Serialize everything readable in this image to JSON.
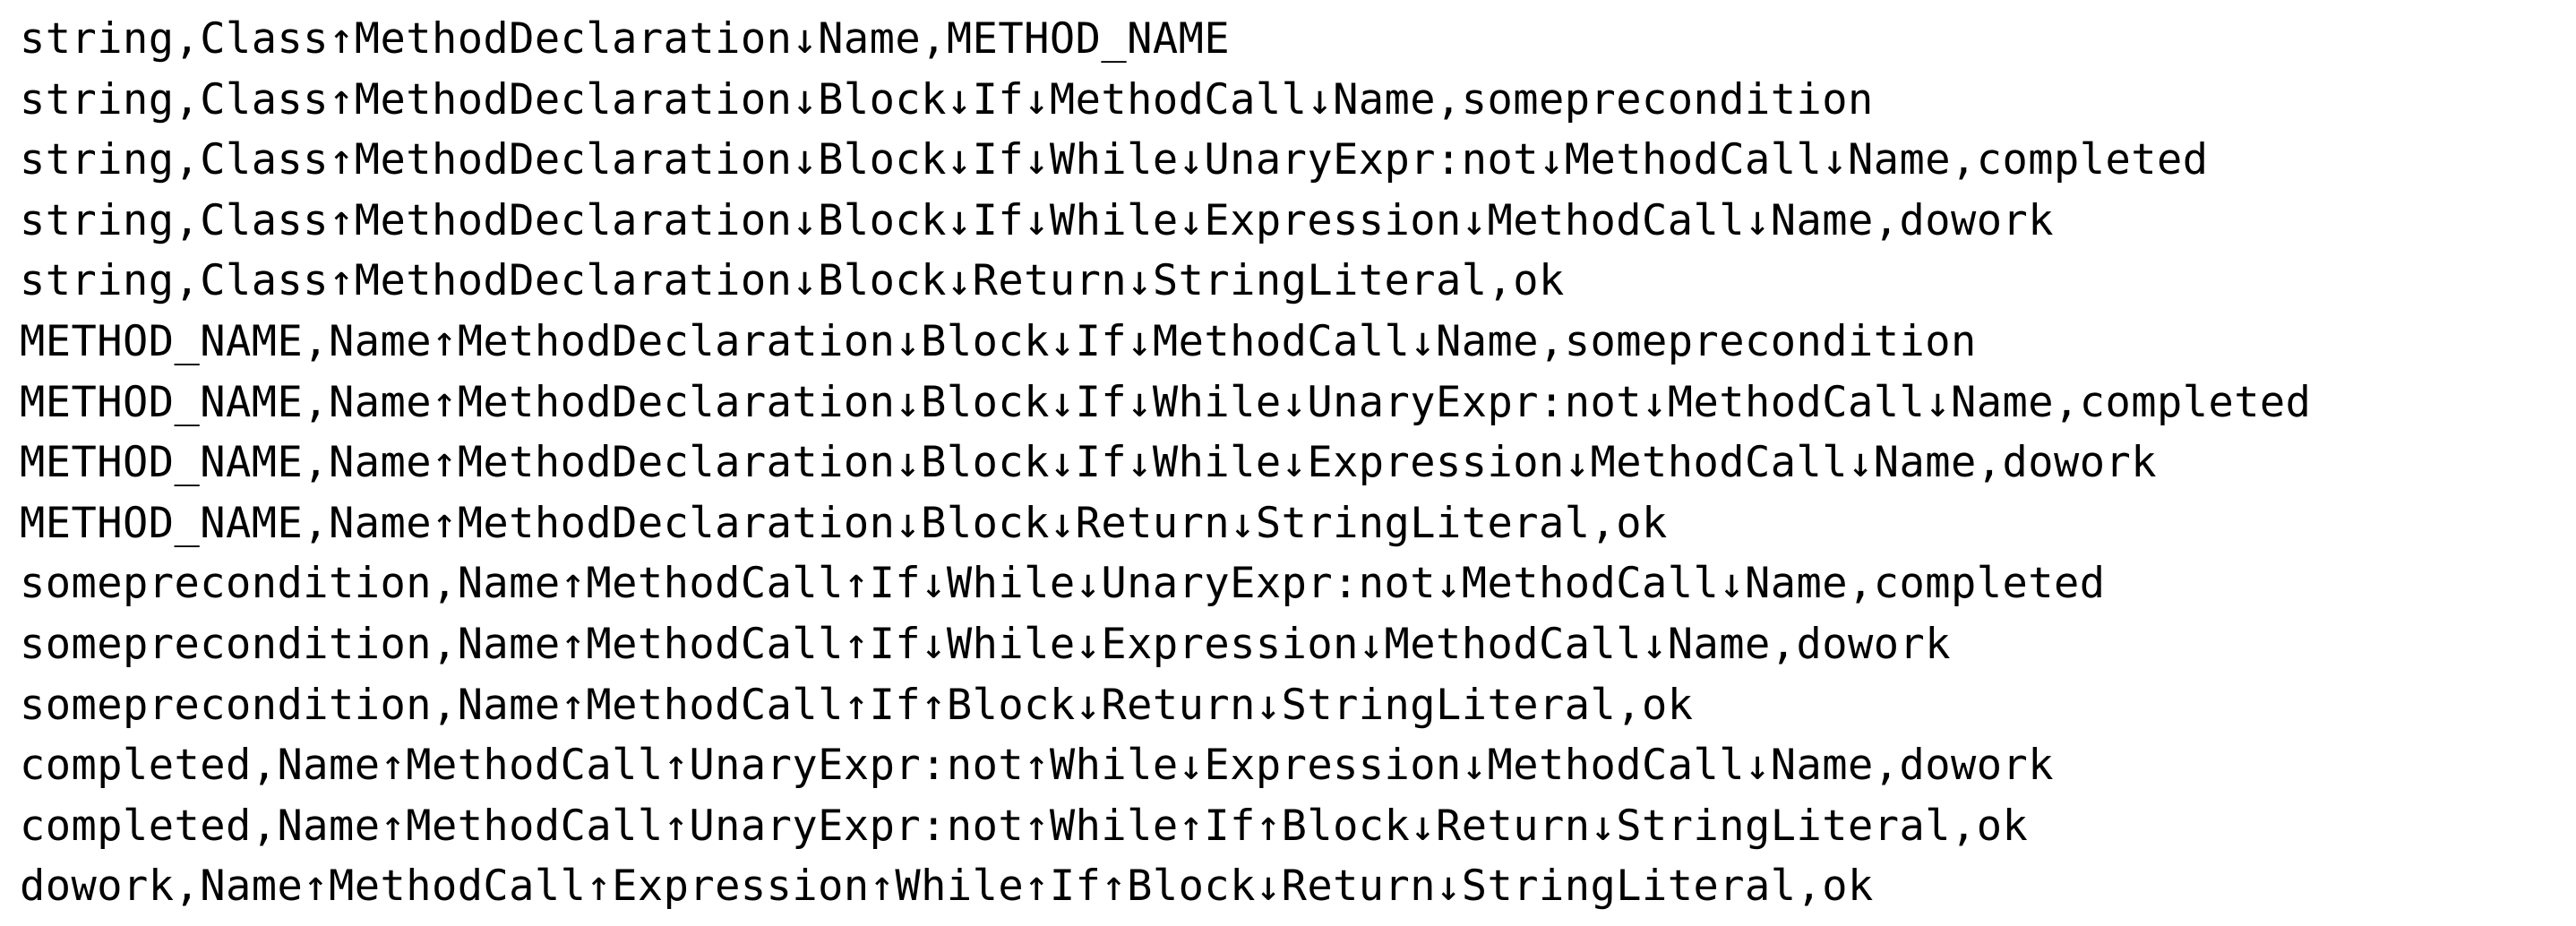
{
  "lines": [
    "string,Class↑MethodDeclaration↓Name,METHOD_NAME",
    "string,Class↑MethodDeclaration↓Block↓If↓MethodCall↓Name,someprecondition",
    "string,Class↑MethodDeclaration↓Block↓If↓While↓UnaryExpr:not↓MethodCall↓Name,completed",
    "string,Class↑MethodDeclaration↓Block↓If↓While↓Expression↓MethodCall↓Name,dowork",
    "string,Class↑MethodDeclaration↓Block↓Return↓StringLiteral,ok",
    "METHOD_NAME,Name↑MethodDeclaration↓Block↓If↓MethodCall↓Name,someprecondition",
    "METHOD_NAME,Name↑MethodDeclaration↓Block↓If↓While↓UnaryExpr:not↓MethodCall↓Name,completed",
    "METHOD_NAME,Name↑MethodDeclaration↓Block↓If↓While↓Expression↓MethodCall↓Name,dowork",
    "METHOD_NAME,Name↑MethodDeclaration↓Block↓Return↓StringLiteral,ok",
    "someprecondition,Name↑MethodCall↑If↓While↓UnaryExpr:not↓MethodCall↓Name,completed",
    "someprecondition,Name↑MethodCall↑If↓While↓Expression↓MethodCall↓Name,dowork",
    "someprecondition,Name↑MethodCall↑If↑Block↓Return↓StringLiteral,ok",
    "completed,Name↑MethodCall↑UnaryExpr:not↑While↓Expression↓MethodCall↓Name,dowork",
    "completed,Name↑MethodCall↑UnaryExpr:not↑While↑If↑Block↓Return↓StringLiteral,ok",
    "dowork,Name↑MethodCall↑Expression↑While↑If↑Block↓Return↓StringLiteral,ok"
  ]
}
